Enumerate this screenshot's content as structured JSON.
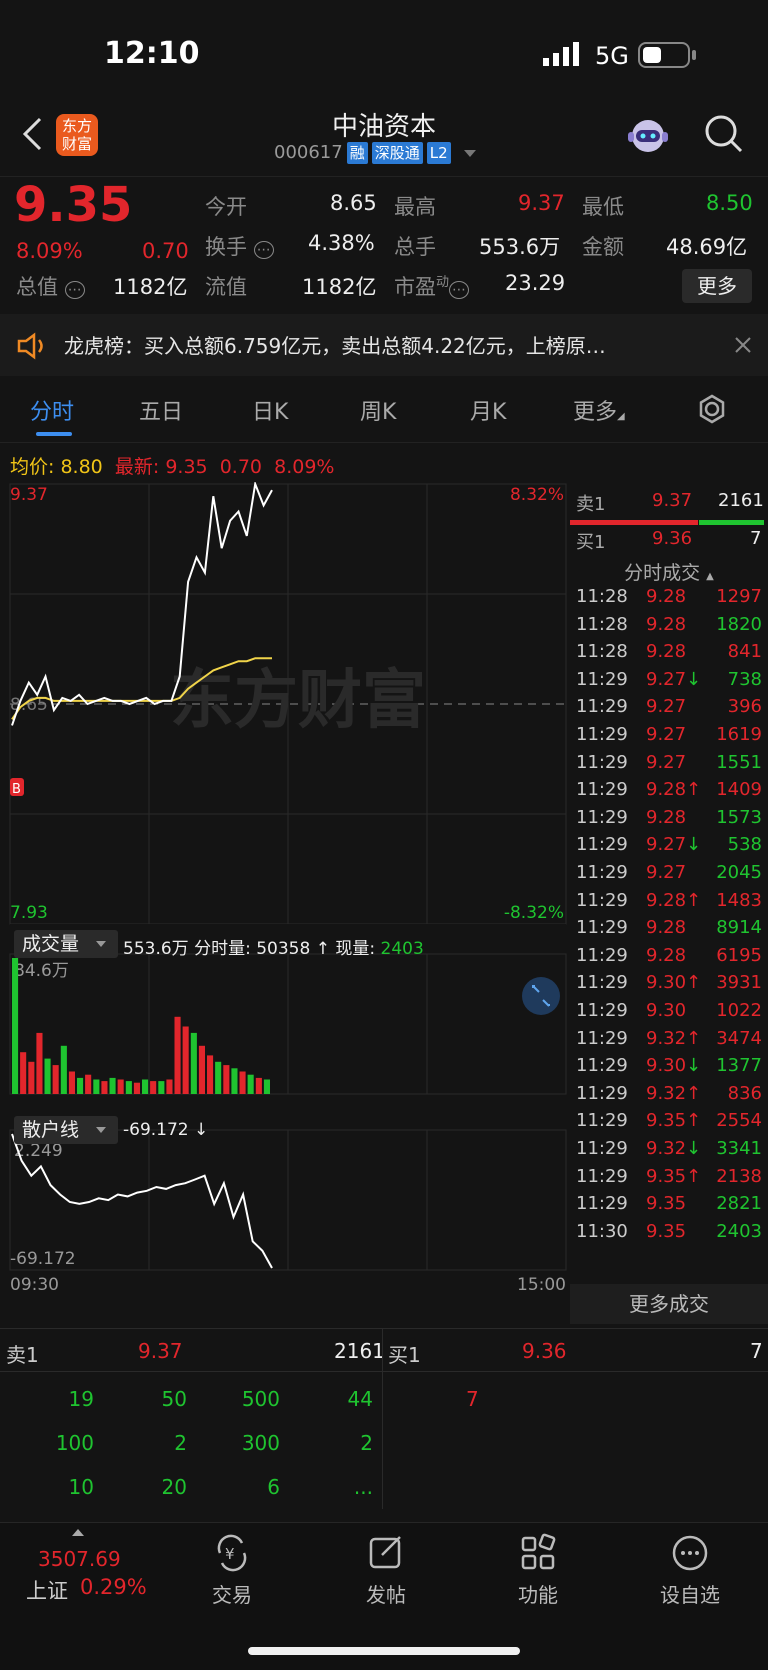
{
  "status": {
    "time": "12:10",
    "network": "5G"
  },
  "header": {
    "title": "中油资本",
    "code": "000617",
    "tags": [
      "融",
      "深股通",
      "L2"
    ],
    "logo_line1": "东方",
    "logo_line2": "财富"
  },
  "quote": {
    "price": "9.35",
    "change_pct": "8.09%",
    "change": "0.70",
    "open_label": "今开",
    "open": "8.65",
    "high_label": "最高",
    "high": "9.37",
    "low_label": "最低",
    "low": "8.50",
    "turnover_label": "换手",
    "turnover": "4.38%",
    "volume_label": "总手",
    "volume": "553.6万",
    "amount_label": "金额",
    "amount": "48.69亿",
    "mcap_label": "总值",
    "mcap": "1182亿",
    "float_label": "流值",
    "float": "1182亿",
    "pe_label": "市盈",
    "pe_sup": "动",
    "pe": "23.29",
    "more_button": "更多"
  },
  "banner": {
    "text": "龙虎榜：买入总额6.759亿元，卖出总额4.22亿元，上榜原…"
  },
  "tabs": [
    "分时",
    "五日",
    "日K",
    "周K",
    "月K",
    "更多"
  ],
  "chart_info": {
    "avg_label": "均价:",
    "avg": "8.80",
    "latest_label": "最新:",
    "latest": "9.35",
    "chg": "0.70",
    "pct": "8.09%",
    "y_top": "9.37",
    "y_bottom": "7.93",
    "pct_top": "8.32%",
    "pct_bottom": "-8.32%",
    "y_mid": "8.65",
    "watermark": "东方财富",
    "vol_selector": "成交量",
    "vol_total": "553.6万",
    "vol_fs_label": "分时量:",
    "vol_fs": "50358 ↑",
    "vol_now_label": "现量:",
    "vol_now": "2403",
    "vol_max": "84.6万",
    "ind_selector": "散户线",
    "ind_value": "-69.172 ↓",
    "ind_top": "2.249",
    "ind_bottom": "-69.172",
    "time_start": "09:30",
    "time_end": "15:00"
  },
  "order_side": {
    "ask_label": "卖1",
    "ask_price": "9.37",
    "ask_vol": "2161",
    "bid_label": "买1",
    "bid_price": "9.36",
    "bid_vol": "7",
    "ticks_title": "分时成交",
    "more_ticks": "更多成交"
  },
  "ticks": [
    {
      "t": "11:28",
      "p": "9.28",
      "a": "",
      "v": "1297",
      "vc": "red"
    },
    {
      "t": "11:28",
      "p": "9.28",
      "a": "",
      "v": "1820",
      "vc": "green"
    },
    {
      "t": "11:28",
      "p": "9.28",
      "a": "",
      "v": "841",
      "vc": "red"
    },
    {
      "t": "11:29",
      "p": "9.27",
      "a": "↓",
      "v": "738",
      "vc": "green"
    },
    {
      "t": "11:29",
      "p": "9.27",
      "a": "",
      "v": "396",
      "vc": "red"
    },
    {
      "t": "11:29",
      "p": "9.27",
      "a": "",
      "v": "1619",
      "vc": "red"
    },
    {
      "t": "11:29",
      "p": "9.27",
      "a": "",
      "v": "1551",
      "vc": "green"
    },
    {
      "t": "11:29",
      "p": "9.28",
      "a": "↑",
      "v": "1409",
      "vc": "red"
    },
    {
      "t": "11:29",
      "p": "9.28",
      "a": "",
      "v": "1573",
      "vc": "green"
    },
    {
      "t": "11:29",
      "p": "9.27",
      "a": "↓",
      "v": "538",
      "vc": "green"
    },
    {
      "t": "11:29",
      "p": "9.27",
      "a": "",
      "v": "2045",
      "vc": "green"
    },
    {
      "t": "11:29",
      "p": "9.28",
      "a": "↑",
      "v": "1483",
      "vc": "red"
    },
    {
      "t": "11:29",
      "p": "9.28",
      "a": "",
      "v": "8914",
      "vc": "green"
    },
    {
      "t": "11:29",
      "p": "9.28",
      "a": "",
      "v": "6195",
      "vc": "red"
    },
    {
      "t": "11:29",
      "p": "9.30",
      "a": "↑",
      "v": "3931",
      "vc": "red"
    },
    {
      "t": "11:29",
      "p": "9.30",
      "a": "",
      "v": "1022",
      "vc": "red"
    },
    {
      "t": "11:29",
      "p": "9.32",
      "a": "↑",
      "v": "3474",
      "vc": "red"
    },
    {
      "t": "11:29",
      "p": "9.30",
      "a": "↓",
      "v": "1377",
      "vc": "green"
    },
    {
      "t": "11:29",
      "p": "9.32",
      "a": "↑",
      "v": "836",
      "vc": "red"
    },
    {
      "t": "11:29",
      "p": "9.35",
      "a": "↑",
      "v": "2554",
      "vc": "red"
    },
    {
      "t": "11:29",
      "p": "9.32",
      "a": "↓",
      "v": "3341",
      "vc": "green"
    },
    {
      "t": "11:29",
      "p": "9.35",
      "a": "↑",
      "v": "2138",
      "vc": "red"
    },
    {
      "t": "11:29",
      "p": "9.35",
      "a": "",
      "v": "2821",
      "vc": "green"
    },
    {
      "t": "11:30",
      "p": "9.35",
      "a": "",
      "v": "2403",
      "vc": "green"
    }
  ],
  "orderbook": {
    "ask_label": "卖1",
    "ask_price": "9.37",
    "ask_vol": "2161",
    "bid_label": "买1",
    "bid_price": "9.36",
    "bid_vol": "7",
    "ask_queue": [
      [
        "19",
        "50",
        "500",
        "44"
      ],
      [
        "100",
        "2",
        "300",
        "2"
      ],
      [
        "10",
        "20",
        "6",
        "..."
      ]
    ],
    "bid_queue": [
      "7"
    ]
  },
  "nav": {
    "index_value": "3507.69",
    "index_name": "上证",
    "index_pct": "0.29%",
    "items": [
      "交易",
      "发帖",
      "功能",
      "设自选"
    ]
  },
  "chart_data": {
    "type": "line",
    "title": "",
    "ylim": [
      7.93,
      9.37
    ],
    "prev_close": 8.65,
    "price_series": [
      8.58,
      8.66,
      8.72,
      8.68,
      8.74,
      8.63,
      8.67,
      8.66,
      8.68,
      8.65,
      8.66,
      8.67,
      8.66,
      8.66,
      8.65,
      8.66,
      8.67,
      8.65,
      8.66,
      8.66,
      8.74,
      9.05,
      9.13,
      9.08,
      9.33,
      9.16,
      9.25,
      9.28,
      9.2,
      9.37,
      9.3,
      9.35
    ],
    "avg_series": [
      8.6,
      8.64,
      8.66,
      8.67,
      8.67,
      8.66,
      8.66,
      8.66,
      8.66,
      8.66,
      8.66,
      8.66,
      8.66,
      8.66,
      8.66,
      8.66,
      8.66,
      8.66,
      8.66,
      8.66,
      8.67,
      8.7,
      8.72,
      8.74,
      8.76,
      8.77,
      8.78,
      8.79,
      8.79,
      8.8,
      8.8,
      8.8
    ],
    "volume_series": [
      84.6,
      26,
      20,
      38,
      22,
      18,
      30,
      14,
      10,
      12,
      9,
      8,
      10,
      9,
      8,
      7,
      9,
      8,
      8,
      9,
      48,
      42,
      38,
      30,
      24,
      20,
      18,
      16,
      14,
      12,
      10,
      9
    ],
    "volume_colors": [
      "g",
      "r",
      "r",
      "r",
      "g",
      "r",
      "g",
      "r",
      "g",
      "r",
      "g",
      "r",
      "g",
      "r",
      "g",
      "r",
      "g",
      "r",
      "g",
      "r",
      "r",
      "r",
      "g",
      "r",
      "r",
      "g",
      "r",
      "g",
      "r",
      "g",
      "r",
      "g"
    ],
    "indicator_series": [
      2.249,
      -12,
      -20,
      -15,
      -25,
      -30,
      -34,
      -35,
      -34,
      -32,
      -33,
      -30,
      -31,
      -29,
      -28,
      -26,
      -27,
      -25,
      -24,
      -22,
      -20,
      -35,
      -24,
      -42,
      -30,
      -55,
      -60,
      -69.172
    ]
  }
}
